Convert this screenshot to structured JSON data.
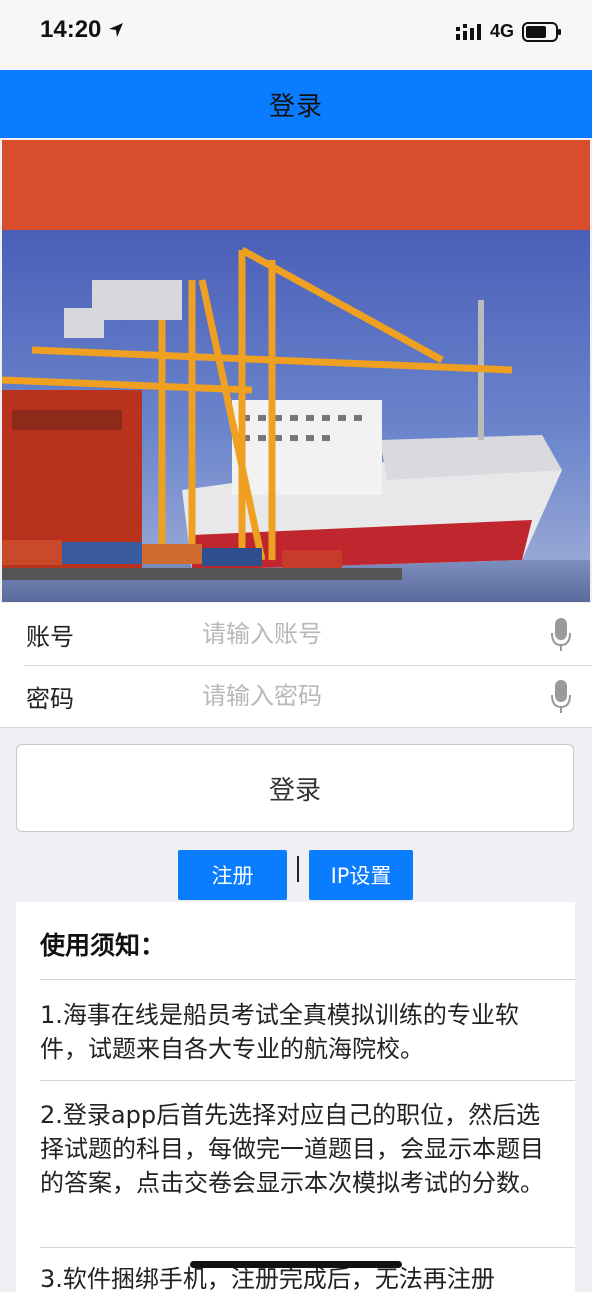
{
  "status_bar": {
    "time": "14:20",
    "network": "4G",
    "icons": [
      "location-arrow-icon",
      "signal-icon",
      "battery-icon"
    ]
  },
  "nav": {
    "title": "登录"
  },
  "banner": {
    "description_icon": "cargo-ship-port-image"
  },
  "form": {
    "account_label": "账号",
    "account_placeholder": "请输入账号",
    "password_label": "密码",
    "password_placeholder": "请输入密码"
  },
  "buttons": {
    "login": "登录",
    "register": "注册",
    "ip_settings": "IP设置"
  },
  "notice": {
    "title": "使用须知：",
    "items": [
      "1.海事在线是船员考试全真模拟训练的专业软件，试题来自各大专业的航海院校。",
      "2.登录app后首先选择对应自己的职位，然后选择试题的科目，每做完一道题目，会显示本题目的答案，点击交卷会显示本次模拟考试的分数。",
      "3.软件捆绑手机，注册完成后，无法再注册"
    ]
  },
  "colors": {
    "accent": "#0a7cff",
    "banner_top": "#d84d2c",
    "background": "#efeff4"
  }
}
